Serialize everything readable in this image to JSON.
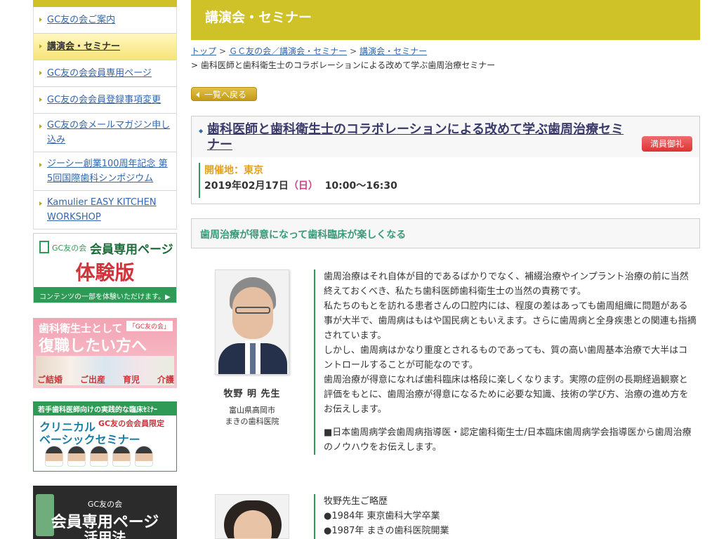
{
  "sidebar": {
    "nav": [
      {
        "label": "GC友の会ご案内",
        "active": false
      },
      {
        "label": "講演会・セミナー",
        "active": true
      },
      {
        "label": "GC友の会会員専用ページ",
        "active": false
      },
      {
        "label": "GC友の会会員登録事項変更",
        "active": false
      },
      {
        "label": "GC友の会メールマガジン申し込み",
        "active": false
      },
      {
        "label": "ジーシー創業100周年記念 第5回国際歯科シンポジウム",
        "active": false
      },
      {
        "label": "Kamulier EASY KITCHEN WORKSHOP",
        "active": false
      }
    ],
    "banners": {
      "trial": {
        "small": "GC友の会",
        "main": "会員専用ページ",
        "big": "体験版",
        "bottom": "コンテンツの一部を体験いただけます。▶"
      },
      "return": {
        "line1": "歯科衛生士として",
        "tag": "「GC友の会」",
        "line2": "復職したい方へ",
        "captions": [
          "ご結婚",
          "ご出産",
          "育児",
          "介護"
        ]
      },
      "clinical": {
        "top": "若手歯科医師向けの実践的な臨床ｾﾐﾅｰ",
        "line1": "クリニカル",
        "tag": "GC友の会会員限定",
        "line2": "ベーシックセミナー"
      },
      "members": {
        "line1": "GC友の会",
        "line2": "会員専用ページ",
        "line3": "活用法"
      }
    }
  },
  "header": {
    "title": "講演会・セミナー"
  },
  "breadcrumb": {
    "links": [
      "トップ",
      "ＧＣ友の会／講演会・セミナー",
      "講演会・セミナー"
    ],
    "current": "歯科医師と歯科衛生士のコラボレーションによる改めて学ぶ歯周治療セミナー",
    "sep": ">"
  },
  "back_button": "一覧へ戻る",
  "event": {
    "title": "歯科医師と歯科衛生士のコラボレーションによる改めて学ぶ歯周治療セミナー",
    "badge": "満員御礼",
    "venue": "開催地：東京",
    "date": "2019年02月17日",
    "dow": "（日）",
    "time": "10:00〜16:30"
  },
  "section": {
    "heading": "歯周治療が得意になって歯科臨床が楽しくなる"
  },
  "speaker": {
    "name": "牧野 明 先生",
    "affiliation": [
      "富山県高岡市",
      "まきの歯科医院"
    ]
  },
  "body": {
    "paragraphs": [
      "歯周治療はそれ自体が目的であるばかりでなく、補綴治療やインプラント治療の前に当然終えておくべき、私たち歯科医師歯科衛生士の当然の責務です。",
      "私たちのもとを訪れる患者さんの口腔内には、程度の差はあっても歯周組織に問題がある事が大半で、歯周病はもはや国民病ともいえます。さらに歯周病と全身疾患との関連も指摘されています。",
      "しかし、歯周病はかなり重度とされるものであっても、質の高い歯周基本治療で大半はコントロールすることが可能なのです。",
      "歯周治療が得意になれば歯科臨床は格段に楽しくなります。実際の症例の長期経過観察と評価をもとに、歯周治療が得意になるために必要な知識、技術の学び方、治療の進め方をお伝えします。"
    ],
    "note": "■日本歯周病学会歯周病指導医・認定歯科衛生士/日本臨床歯周病学会指導医から歯周治療のノウハウをお伝えします。"
  },
  "bio": {
    "heading": "牧野先生ご略歴",
    "items": [
      "●1984年 東京歯科大学卒業",
      "●1987年 まきの歯科医院開業"
    ]
  },
  "colors": {
    "accent": "#cfc128",
    "link": "#3366aa",
    "green": "#2e9a55",
    "badge": "#d33333",
    "venue": "#e6a118"
  }
}
